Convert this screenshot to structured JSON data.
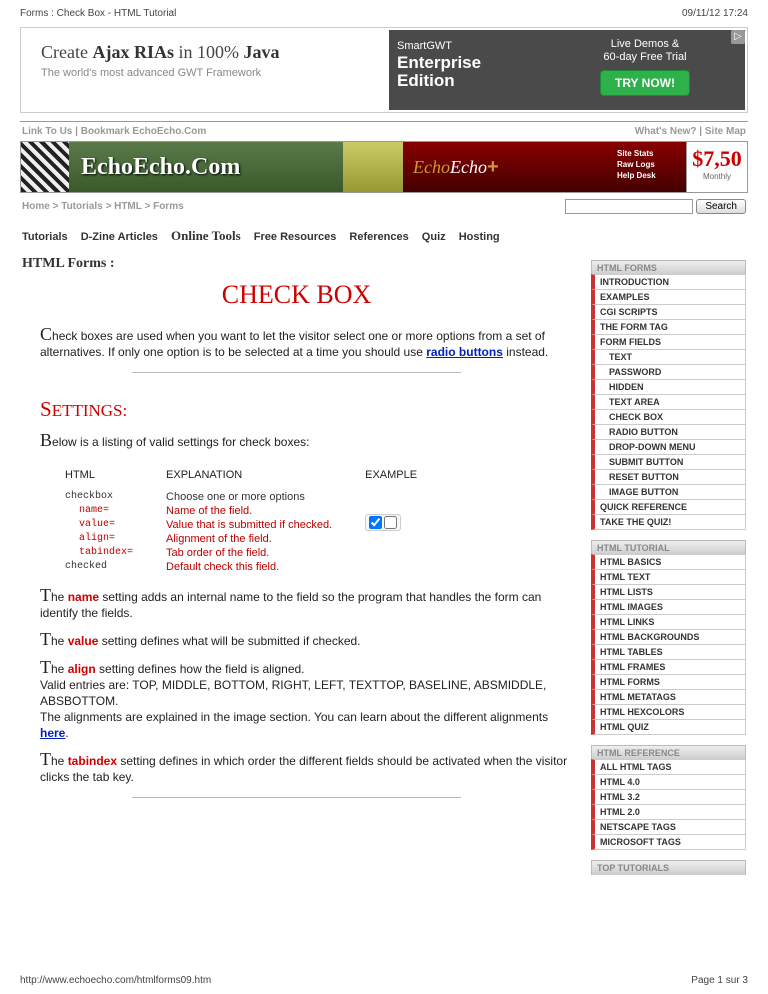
{
  "header": {
    "title": "Forms : Check Box - HTML Tutorial",
    "date": "09/11/12 17:24"
  },
  "ad": {
    "l1a": "Create ",
    "l1b": "Ajax RIAs",
    "l1c": " in 100% ",
    "l1d": "Java",
    "l2": "The world's most advanced GWT Framework",
    "m1": "SmartGWT",
    "m2a": "Enterprise",
    "m2b": "Edition",
    "r1": "Live Demos &",
    "r2": "60-day Free Trial",
    "try": "TRY NOW!"
  },
  "toplinks": {
    "left": "Link To Us | Bookmark EchoEcho.Com",
    "right": "What's New? | Site Map"
  },
  "banner": {
    "title": "EchoEcho.Com",
    "e1": "Echo",
    "e2": "Echo",
    "s1": "Site Stats",
    "s2": "Raw Logs",
    "s3": "Help Desk",
    "price": "$7,50",
    "per": "Monthly"
  },
  "crumbs": {
    "c1": "Home",
    "c2": "Tutorials",
    "c3": "HTML",
    "c4": "Forms",
    "sep": " > ",
    "search": "Search"
  },
  "tabs": [
    "Tutorials",
    "D-Zine Articles",
    "Online Tools",
    "Free Resources",
    "References",
    "Quiz",
    "Hosting"
  ],
  "page": {
    "forms_h": "HTML Forms :",
    "title": "CHECK BOX",
    "intro_drop": "C",
    "intro": "heck boxes are used when you want to let the visitor select one or more options from a set of alternatives. If only one option is to be selected at a time you should use ",
    "intro_link": "radio buttons",
    "intro_after": " instead.",
    "settings_h": "SETTINGS:",
    "below_drop": "B",
    "below": "elow is a listing of valid settings for check boxes:",
    "th1": "HTML",
    "th2": "EXPLANATION",
    "th3": "EXAMPLE",
    "code": {
      "l1": "checkbox",
      "l2": "name=",
      "l3": "value=",
      "l4": "align=",
      "l5": "tabindex=",
      "l6": "checked"
    },
    "exp": {
      "l1": "Choose one or more options",
      "l2": "Name of the field.",
      "l3": "Value that is submitted if checked.",
      "l4": "Alignment of the field.",
      "l5": "Tab order of the field.",
      "l6": "Default check this field."
    },
    "p_name": {
      "d": "T",
      "t1": "he ",
      "s": "name",
      "t2": " setting adds an internal name to the field so the program that handles the form can identify the fields."
    },
    "p_value": {
      "d": "T",
      "t1": "he ",
      "s": "value",
      "t2": " setting defines what will be submitted if checked."
    },
    "p_align": {
      "d": "T",
      "t1": "he ",
      "s": "align",
      "t2": " setting defines how the field is aligned.",
      "t3": "Valid entries are: TOP, MIDDLE, BOTTOM, RIGHT, LEFT, TEXTTOP, BASELINE, ABSMIDDLE, ABSBOTTOM.",
      "t4": "The alignments are explained in the image section. You can learn about the different alignments ",
      "link": "here",
      "t5": "."
    },
    "p_tab": {
      "d": "T",
      "t1": "he ",
      "s": "tabindex",
      "t2": " setting defines in which order the different fields should be activated when the visitor clicks the tab key."
    }
  },
  "sb": {
    "h1": "HTML FORMS",
    "g1": [
      "INTRODUCTION",
      "EXAMPLES",
      "CGI SCRIPTS",
      "THE FORM TAG",
      "FORM FIELDS"
    ],
    "g1s": [
      "TEXT",
      "PASSWORD",
      "HIDDEN",
      "TEXT AREA",
      "CHECK BOX",
      "RADIO BUTTON",
      "DROP-DOWN MENU",
      "SUBMIT BUTTON",
      "RESET BUTTON",
      "IMAGE BUTTON"
    ],
    "g1b": [
      "QUICK REFERENCE",
      "TAKE THE QUIZ!"
    ],
    "h2": "HTML TUTORIAL",
    "g2": [
      "HTML BASICS",
      "HTML TEXT",
      "HTML LISTS",
      "HTML IMAGES",
      "HTML LINKS",
      "HTML BACKGROUNDS",
      "HTML TABLES",
      "HTML FRAMES",
      "HTML FORMS",
      "HTML METATAGS",
      "HTML HEXCOLORS",
      "HTML QUIZ"
    ],
    "h3": "HTML REFERENCE",
    "g3": [
      "ALL HTML TAGS",
      "HTML 4.0",
      "HTML 3.2",
      "HTML 2.0",
      "NETSCAPE TAGS",
      "MICROSOFT TAGS"
    ],
    "h4": "TOP TUTORIALS"
  },
  "footer": {
    "url": "http://www.echoecho.com/htmlforms09.htm",
    "page": "Page 1 sur 3"
  }
}
